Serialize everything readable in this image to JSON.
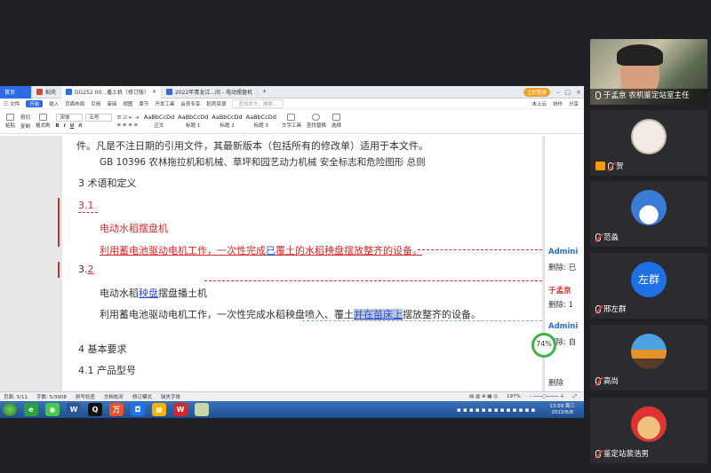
{
  "screen": {
    "tabs": {
      "home": "首页",
      "t1": "稻壳",
      "t2": "DG252 00...播土机（修订版）",
      "t3": "2022年青龙江...间 - 电动摆盘机",
      "add": "+"
    },
    "login": "立即登录",
    "menu": [
      "三 文件",
      "开始",
      "插入",
      "页面布局",
      "引用",
      "审阅",
      "视图",
      "章节",
      "开发工具",
      "会员专享",
      "稻壳资源",
      "查找命令、搜索..."
    ],
    "menu_right": [
      "未上云",
      "协作",
      "分享"
    ],
    "ribbon": {
      "paste": "粘贴",
      "cut": "剪切",
      "copy": "复制",
      "format_painter": "格式刷",
      "font": "宋体",
      "size": "五号",
      "styles": [
        "AaBbCcDd",
        "AaBbCcDd",
        "AaBbCcDd",
        "AaBbCcDd"
      ],
      "style_names": [
        "正文",
        "标题 1",
        "标题 2",
        "标题 3"
      ],
      "text_tools": "文字工具",
      "find": "查找替换",
      "select": "选择"
    },
    "doc": {
      "line_top": "件。凡是不注日期的引用文件，其最新版本（包括所有的修改单）适用于本文件。",
      "ref": "GB 10396  农林拖拉机和机械、草坪和园艺动力机械   安全标志和危险图形   总则",
      "sec3": "3    术语和定义",
      "n31": "3.1",
      "term1": "电动水稻摆盘机",
      "def1_a": "利用蓄电池驱动电机工作，一次性完成",
      "def1_b": "已",
      "def1_c": "覆土的水稻秧盘摆放整齐的设备。",
      "n32a": "3.",
      "n32b": "2",
      "term2_a": "电动水稻",
      "term2_b": "秧盘",
      "term2_c": "摆盘播土机",
      "def2_a": "利用蓄电池驱动电机工作，一次性完成水稻秧盘喷入、覆土",
      "def2_b": "并在苗床上",
      "def2_c": "摆放整齐的设备。",
      "sec4": "4    基本要求",
      "sec41": "4.1    产品型号"
    },
    "comments": [
      {
        "author": "Admini",
        "text": "删除: 已"
      },
      {
        "author": "于孟京",
        "text": "删除: 1"
      },
      {
        "author": "Admini",
        "text": "删除: 自"
      },
      {
        "author": "",
        "text": "删除"
      }
    ],
    "zoom_badge": "74%",
    "status": {
      "page": "页面: 5/11",
      "words": "字数: 5/3908",
      "spell": "拼写检查",
      "doc_check": "文档校对",
      "revise": "修订模式",
      "missing_font": "缺失字体",
      "zoom": "197%"
    },
    "clock": {
      "time": "13:59 周三",
      "date": "2022/6/8"
    }
  },
  "participants": [
    {
      "name": "于孟京",
      "role": "农机鉴定站室主任",
      "video": true
    },
    {
      "name": "贺",
      "host": true
    },
    {
      "name": "范淼"
    },
    {
      "name": "邢左群",
      "avatar_text": "左群"
    },
    {
      "name": "高尚"
    },
    {
      "name": "鉴定站裴浩男"
    }
  ],
  "colors": {
    "accent": "#2d6be6",
    "tracked_red": "#d72b2b",
    "insert_blue": "#2b4fd7",
    "panel_bg": "#2b2c30"
  }
}
